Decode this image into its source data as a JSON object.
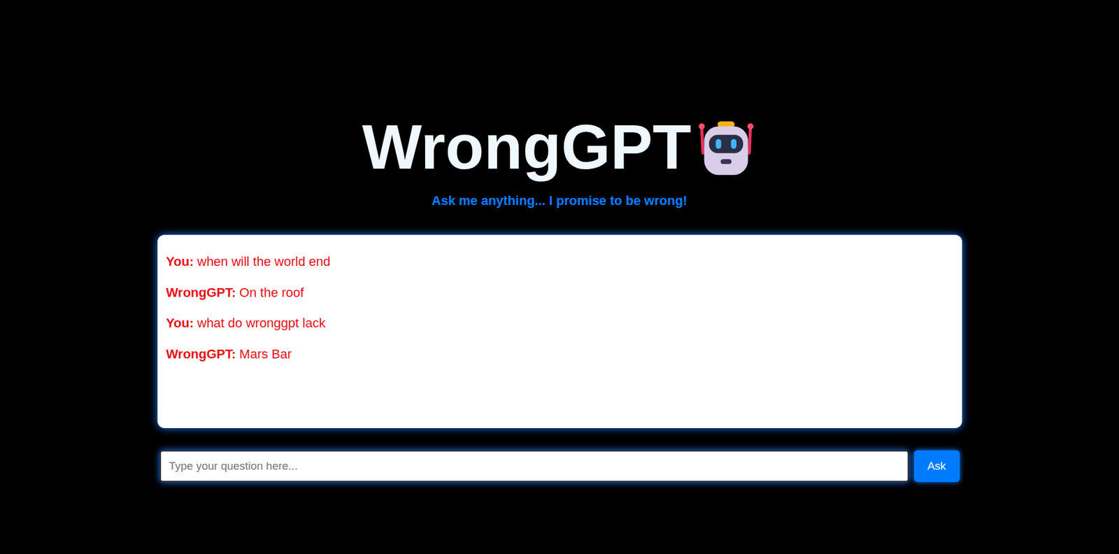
{
  "app": {
    "title": "WrongGPT",
    "tagline": "Ask me anything... I promise to be wrong!"
  },
  "messages": [
    {
      "speaker": "You:",
      "text": "when will the world end"
    },
    {
      "speaker": "WrongGPT:",
      "text": "On the roof"
    },
    {
      "speaker": "You:",
      "text": "what do wronggpt lack"
    },
    {
      "speaker": "WrongGPT:",
      "text": "Mars Bar"
    }
  ],
  "input": {
    "placeholder": "Type your question here..."
  },
  "ask_button": {
    "label": "Ask"
  }
}
